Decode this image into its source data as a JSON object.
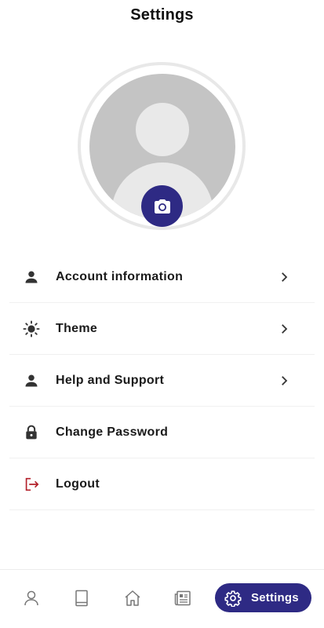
{
  "header": {
    "title": "Settings"
  },
  "colors": {
    "primary": "#2e2a84",
    "logout_red": "#b3202a",
    "icon_dark": "#333333"
  },
  "menu": {
    "items": [
      {
        "label": "Account information",
        "icon": "person-icon",
        "has_chevron": true
      },
      {
        "label": "Theme",
        "icon": "sun-icon",
        "has_chevron": true
      },
      {
        "label": "Help and Support",
        "icon": "person-icon",
        "has_chevron": true
      },
      {
        "label": "Change Password",
        "icon": "lock-icon",
        "has_chevron": false
      },
      {
        "label": "Logout",
        "icon": "logout-icon",
        "has_chevron": false
      }
    ]
  },
  "bottom_nav": {
    "items": [
      {
        "icon": "profile-icon"
      },
      {
        "icon": "book-icon"
      },
      {
        "icon": "home-icon"
      },
      {
        "icon": "news-icon"
      }
    ],
    "active": {
      "label": "Settings",
      "icon": "gear-icon"
    }
  }
}
